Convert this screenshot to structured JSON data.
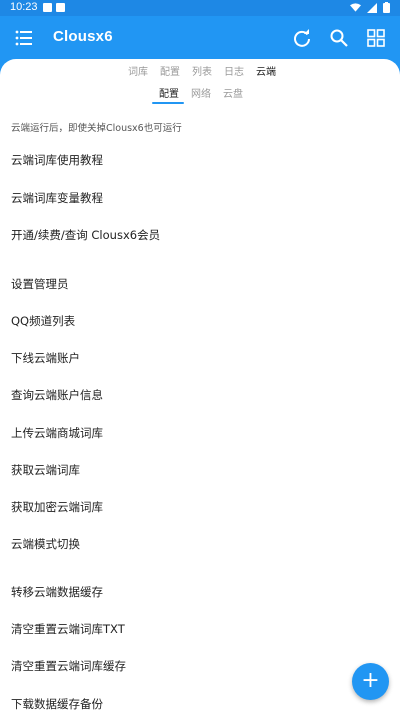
{
  "status_bar": {
    "time": "10:23",
    "icons": [
      "notification-a-icon",
      "notification-square-icon",
      "wifi-icon",
      "signal-icon",
      "battery-icon"
    ]
  },
  "app_bar": {
    "title": "Clousx6",
    "menu_icon": "list-menu-icon",
    "actions": [
      "refresh-icon",
      "search-icon",
      "grid-view-icon"
    ],
    "color": "#2196F3"
  },
  "tabs_primary": [
    "词库",
    "配置",
    "列表",
    "日志",
    "云端"
  ],
  "tabs_primary_active": "云端",
  "tabs_secondary": [
    "配置",
    "网络",
    "云盘"
  ],
  "tabs_secondary_active": "配置",
  "note": "云端运行后，即使关掉Clousx6也可运行",
  "items": [
    "云端词库使用教程",
    "云端词库变量教程",
    "开通/续费/查询 Clousx6会员",
    "设置管理员",
    "QQ频道列表",
    "下线云端账户",
    "查询云端账户信息",
    "上传云端商城词库",
    "获取云端词库",
    "获取加密云端词库",
    "云端模式切换",
    "转移云端数据缓存",
    "清空重置云端词库TXT",
    "清空重置云端词库缓存",
    "下载数据缓存备份"
  ],
  "fab": {
    "label": "+",
    "icon": "plus-icon"
  }
}
